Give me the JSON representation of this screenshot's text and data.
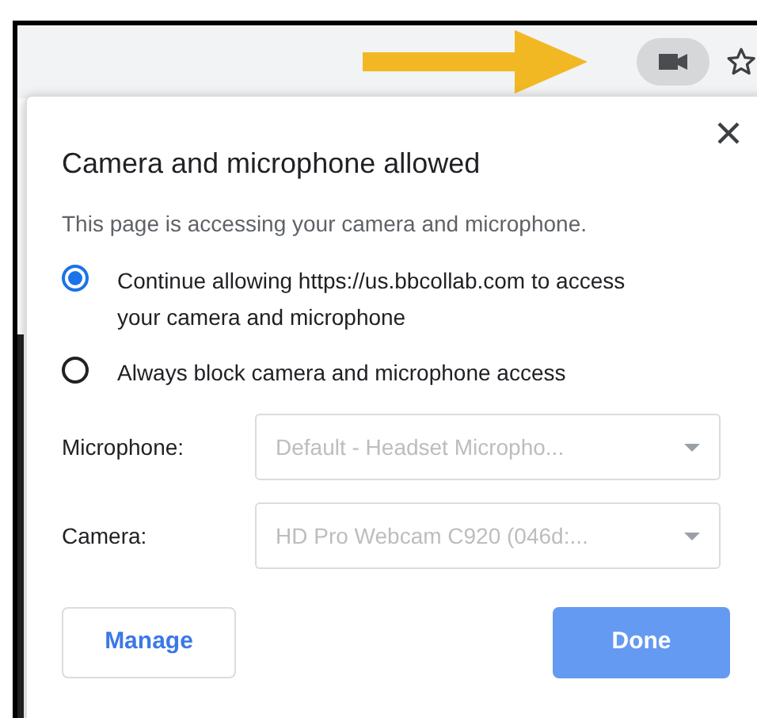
{
  "dialog": {
    "title": "Camera and microphone allowed",
    "message": "This page is accessing your camera and microphone.",
    "options": [
      {
        "label": "Continue allowing https://us.bbcollab.com to access your camera and microphone",
        "selected": true
      },
      {
        "label": "Always block camera and microphone access",
        "selected": false
      }
    ],
    "fields": [
      {
        "label": "Microphone:",
        "value": "Default - Headset Micropho..."
      },
      {
        "label": "Camera:",
        "value": "HD Pro Webcam C920 (046d:..."
      }
    ],
    "buttons": [
      {
        "label": "Manage",
        "kind": "secondary"
      },
      {
        "label": "Done",
        "kind": "primary"
      }
    ]
  }
}
